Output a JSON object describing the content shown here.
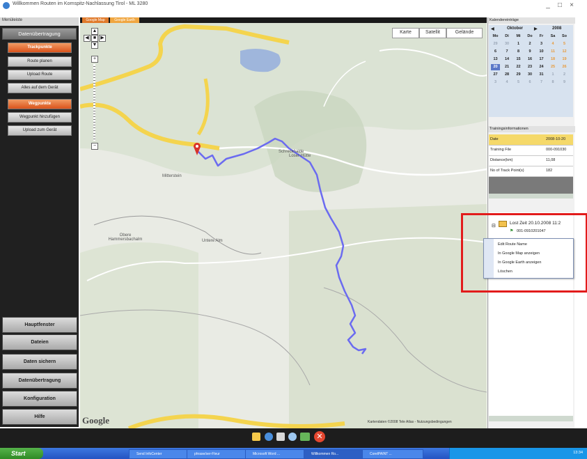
{
  "window": {
    "title": "Willkommen Routen im Kornspitz-Nachlassung Tirol - ML 3280"
  },
  "sidebar": {
    "top_label": "Menüleiste",
    "section1_head": "Datenübertragung",
    "track_buttons": [
      "Trackpunkte",
      "Route planen",
      "Upload Route",
      "Alles auf dem Gerät"
    ],
    "section2_head": "Wegpunkte",
    "waypoint_buttons": [
      "Wegpunkt hinzufügen",
      "Upload zum Gerät"
    ],
    "main_buttons": [
      "Hauptfenster",
      "Dateien",
      "Daten sichern",
      "Datenübertragung",
      "Konfiguration",
      "Hilfe"
    ]
  },
  "map": {
    "tabs": [
      "Google Map",
      "Google Earth"
    ],
    "type_buttons": [
      "Karte",
      "Satellit",
      "Gelände"
    ],
    "labels": [
      "Schreckhalde",
      "Loser-Hütte",
      "Mitterstein",
      "Obere Hammersbachalm",
      "Untere Alm"
    ],
    "google_logo": "Google",
    "copyright": "Kartendaten ©2008 Tele Atlas - Nutzungsbedingungen",
    "route_color": "#6b6bf0",
    "road_color": "#f4d44e"
  },
  "right_panel": {
    "calendar_head": "Kalendereinträge",
    "calendar": {
      "month": "Oktober",
      "year": "2008",
      "weekdays": [
        "Mo",
        "Di",
        "Mi",
        "Do",
        "Fr",
        "Sa",
        "So"
      ],
      "days": [
        "29",
        "30",
        "1",
        "2",
        "3",
        "4",
        "5",
        "6",
        "7",
        "8",
        "9",
        "10",
        "11",
        "12",
        "13",
        "14",
        "15",
        "16",
        "17",
        "18",
        "19",
        "20",
        "21",
        "22",
        "23",
        "24",
        "25",
        "26",
        "27",
        "28",
        "29",
        "30",
        "31",
        "1",
        "2",
        "3",
        "4",
        "5",
        "6",
        "7",
        "8",
        "9"
      ],
      "selected": "20"
    },
    "training_head": "Trainingsinformationen",
    "training": [
      {
        "k": "Date",
        "v": "2008-10-20"
      },
      {
        "k": "Training File",
        "v": "000-091030"
      },
      {
        "k": "Distance(km)",
        "v": "11,08"
      },
      {
        "k": "No of Track Point(s)",
        "v": "182"
      }
    ],
    "tree": {
      "root": "Lost Zeit 20.10.2008 11:2",
      "child": "001-0910201047"
    },
    "context_menu": [
      "Edit Route Name",
      "In Google Map anzeigen",
      "In Google Earth anzeigen",
      "Löschen"
    ]
  },
  "taskbar": {
    "start": "Start",
    "items": [
      "Send InfoCenter",
      "phrase/ser-Fleur",
      "Microsoft Word ...",
      "Willkommen Ro...",
      "CorelPAINT ..."
    ],
    "clock": "13:34"
  }
}
